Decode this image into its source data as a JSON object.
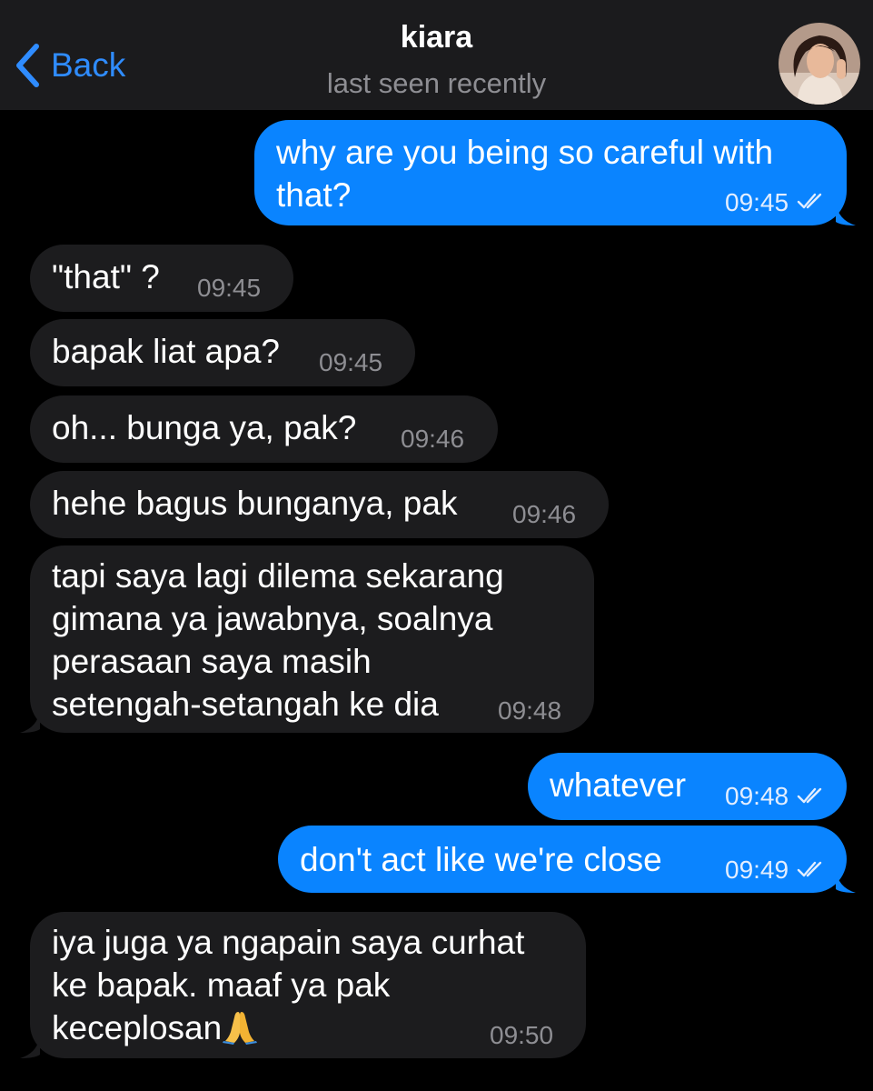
{
  "header": {
    "back_label": "Back",
    "contact_name": "kiara",
    "status": "last seen recently"
  },
  "messages": [
    {
      "direction": "outgoing",
      "lines": [
        "why are you being so careful with",
        "that?"
      ],
      "time": "09:45",
      "read": true
    },
    {
      "direction": "incoming",
      "lines": [
        "\"that\" ?"
      ],
      "time": "09:45"
    },
    {
      "direction": "incoming",
      "lines": [
        "bapak liat apa?"
      ],
      "time": "09:45"
    },
    {
      "direction": "incoming",
      "lines": [
        "oh... bunga ya, pak?"
      ],
      "time": "09:46"
    },
    {
      "direction": "incoming",
      "lines": [
        "hehe bagus bunganya, pak"
      ],
      "time": "09:46"
    },
    {
      "direction": "incoming",
      "lines": [
        "tapi saya lagi dilema sekarang",
        "gimana ya jawabnya, soalnya",
        "perasaan saya masih",
        "setengah-setangah ke dia"
      ],
      "time": "09:48"
    },
    {
      "direction": "outgoing",
      "lines": [
        "whatever"
      ],
      "time": "09:48",
      "read": true
    },
    {
      "direction": "outgoing",
      "lines": [
        "don't act like we're close"
      ],
      "time": "09:49",
      "read": true
    },
    {
      "direction": "incoming",
      "lines": [
        "iya juga ya ngapain saya curhat",
        "ke bapak. maaf ya pak",
        "keceplosan"
      ],
      "time": "09:50",
      "emoji": "folded-hands-emoji"
    }
  ],
  "colors": {
    "outgoing_bubble": "#0a84ff",
    "incoming_bubble": "#1c1c1e",
    "accent": "#2f8cff",
    "background": "#000000"
  }
}
